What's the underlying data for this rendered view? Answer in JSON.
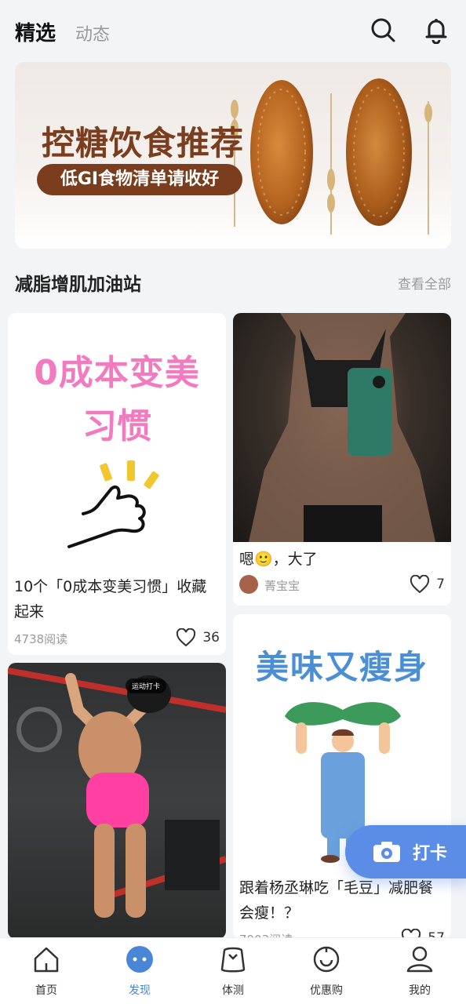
{
  "header": {
    "tab_active": "精选",
    "tab_inactive": "动态",
    "search_icon": "search-icon",
    "bell_icon": "bell-icon"
  },
  "banner": {
    "title": "控糖饮食推荐",
    "subtitle": "低GI食物清单请收好"
  },
  "section": {
    "title": "减脂增肌加油站",
    "view_all": "查看全部"
  },
  "cards": [
    {
      "art_line1": "0成本变美",
      "art_line2": "习惯",
      "title": "10个「0成本变美习惯」收藏起来",
      "reads": "4738阅读",
      "likes": "36"
    },
    {
      "title": "嗯🙂，大了",
      "author": "菁宝宝",
      "likes": "7"
    },
    {
      "photo_tag": "运动打卡"
    },
    {
      "art_title": "美味又瘦身",
      "title": "跟着杨丞琳吃「毛豆」减肥餐会瘦！？",
      "reads": "7903阅读",
      "likes": "57"
    }
  ],
  "fab": {
    "label": "打卡",
    "icon": "camera-icon"
  },
  "bottom_nav": {
    "items": [
      {
        "label": "首页",
        "icon": "home-icon",
        "active": false
      },
      {
        "label": "发现",
        "icon": "discover-icon",
        "active": true
      },
      {
        "label": "体测",
        "icon": "body-test-icon",
        "active": false
      },
      {
        "label": "优惠购",
        "icon": "coupon-icon",
        "active": false
      },
      {
        "label": "我的",
        "icon": "profile-icon",
        "active": false
      }
    ]
  },
  "colors": {
    "accent": "#4a86d8",
    "banner_brown": "#7a3e1e",
    "pink": "#f27bbf",
    "fab_blue": "#5b8ce6"
  }
}
